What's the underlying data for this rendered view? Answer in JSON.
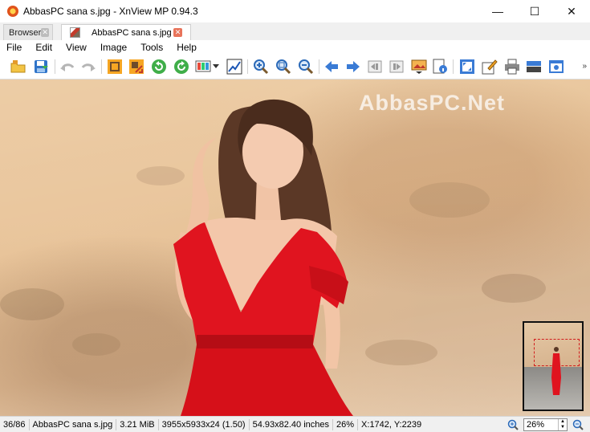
{
  "window": {
    "title": "AbbasPC sana s.jpg - XnView MP 0.94.3",
    "controls": {
      "minimize": "—",
      "maximize": "☐",
      "close": "✕"
    }
  },
  "tabs": [
    {
      "label": "Browser",
      "active": false,
      "close": "✕"
    },
    {
      "label": "AbbasPC sana s.jpg",
      "active": true,
      "close": "✕"
    }
  ],
  "menu": [
    "File",
    "Edit",
    "View",
    "Image",
    "Tools",
    "Help"
  ],
  "toolbar": {
    "icons": [
      "open-folder-icon",
      "save-icon",
      "undo-icon",
      "redo-icon",
      "crop-icon",
      "resize-icon",
      "rotate-left-icon",
      "rotate-right-icon",
      "adjust-icon",
      "dropdown-icon",
      "levels-icon",
      "zoom-in-icon",
      "zoom-fit-icon",
      "zoom-out-icon",
      "previous-icon",
      "next-icon",
      "first-icon",
      "last-icon",
      "slideshow-icon",
      "info-icon",
      "fullscreen-icon",
      "edit-icon",
      "print-icon",
      "scanner-icon",
      "capture-icon"
    ],
    "more": "»"
  },
  "viewer": {
    "watermark": "AbbasPC.Net",
    "thumbnail_visible": true
  },
  "status": {
    "position": "36/86",
    "filename": "AbbasPC sana s.jpg",
    "filesize": "3.21 MiB",
    "dimensions": "3955x5933x24 (1.50)",
    "print_size": "54.93x82.40 inches",
    "zoom_percent": "26%",
    "cursor": "X:1742, Y:2239",
    "zoom_value": "26%"
  },
  "colors": {
    "dress": "#e1131f",
    "accent_close": "#e8735a",
    "toolbar_blue": "#3a7bd5"
  }
}
